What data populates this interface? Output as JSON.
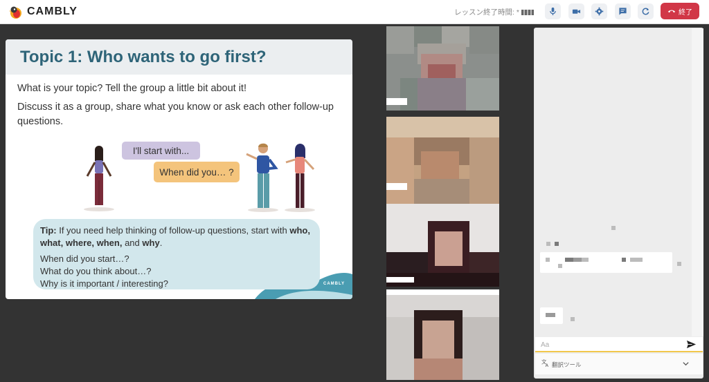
{
  "topbar": {
    "brand": "CAMBLY",
    "lesson_time_label": "レッスン終了時間: *",
    "end_label": "終了",
    "icons": [
      "microphone-icon",
      "camera-icon",
      "settings-icon",
      "chat-icon",
      "refresh-icon",
      "hang-up-icon"
    ],
    "accent": "#d13747"
  },
  "slide": {
    "title": "Topic 1: Who wants to go first?",
    "paragraph1": "What is your topic? Tell the group a little bit about it!",
    "paragraph2": "Discuss it as a group, share what you know or ask each other follow-up questions.",
    "bubble1": "I'll start with...",
    "bubble2": "When did you… ?",
    "tip": {
      "label": "Tip:",
      "intro": " If you need help thinking of follow-up questions, start with ",
      "keywords": "who, what, where, when,",
      "and": " and ",
      "last_keyword": "why",
      "period": ".",
      "line1": "When did you start…?",
      "line2": "What do you think about…?",
      "line3": "Why is it important / interesting?"
    },
    "brand": "CAMBLY",
    "title_color": "#2e6478"
  },
  "chat": {
    "input_placeholder": "Aa",
    "translate_label": "翻訳ツール"
  }
}
